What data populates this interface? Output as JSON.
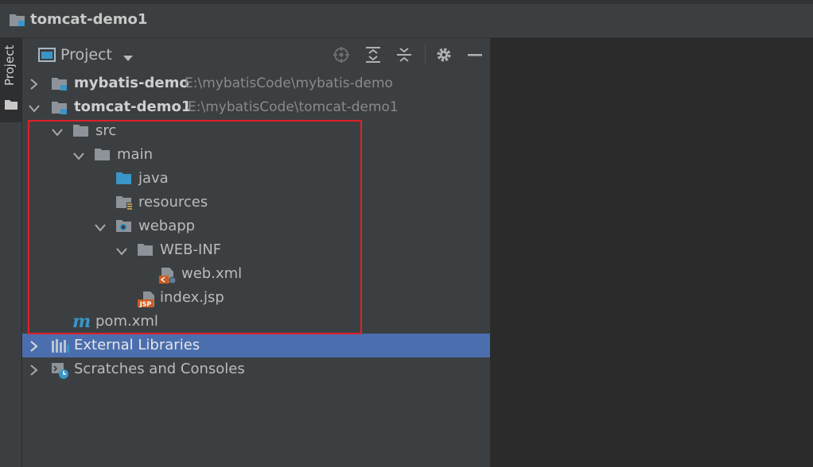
{
  "window": {
    "title": "tomcat-demo1"
  },
  "left_strip": {
    "tab_label": "Project"
  },
  "panel": {
    "title": "Project"
  },
  "tree": {
    "mybatis_demo": {
      "name": "mybatis-demo",
      "path": "E:\\mybatisCode\\mybatis-demo"
    },
    "tomcat_demo1": {
      "name": "tomcat-demo1",
      "path": "E:\\mybatisCode\\tomcat-demo1"
    },
    "src": "src",
    "main": "main",
    "java": "java",
    "resources": "resources",
    "webapp": "webapp",
    "web_inf": "WEB-INF",
    "web_xml": "web.xml",
    "index_jsp": "index.jsp",
    "pom_xml": "pom.xml",
    "external_libraries": "External Libraries",
    "scratches": "Scratches and Consoles"
  },
  "icons": {
    "folder_color": "#8d9399",
    "source_folder_color": "#3a95c9",
    "selected_row_color": "#4b6eaf",
    "highlight_border_color": "#e0202a",
    "jsp_badge": "JSP",
    "maven_glyph": "m"
  }
}
